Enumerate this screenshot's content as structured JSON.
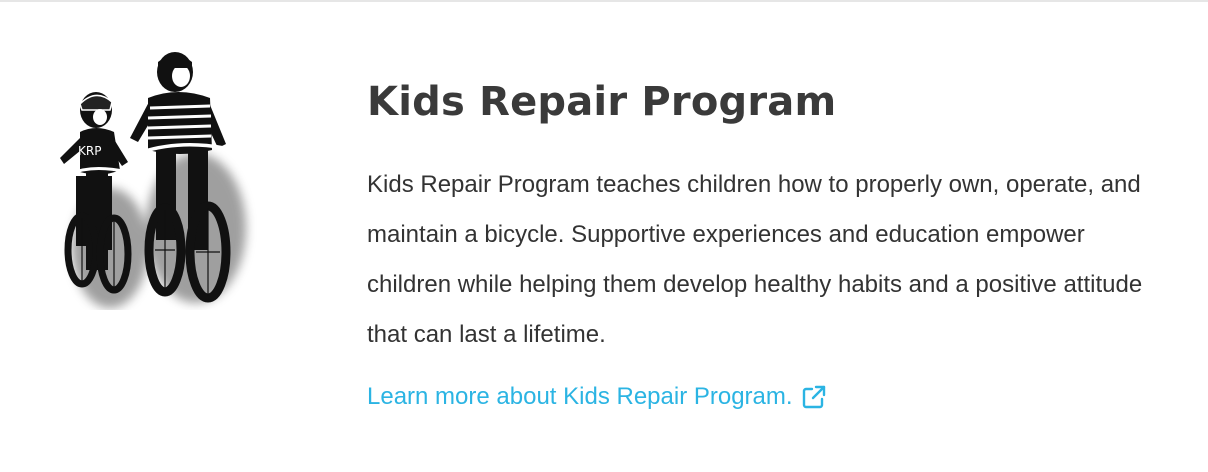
{
  "program": {
    "title": "Kids Repair Program",
    "description": "Kids Repair Program teaches children how to properly own, operate, and maintain a bicycle. Supportive experiences and education empower children while helping them develop healthy habits and a positive attitude that can last a lifetime.",
    "link_label": "Learn more about Kids Repair Program.",
    "link_icon": "external-link-icon"
  },
  "logo": {
    "jersey_text": "KRP"
  },
  "colors": {
    "link": "#2bb4e3",
    "title": "#3a3a3a",
    "body": "#333333"
  }
}
